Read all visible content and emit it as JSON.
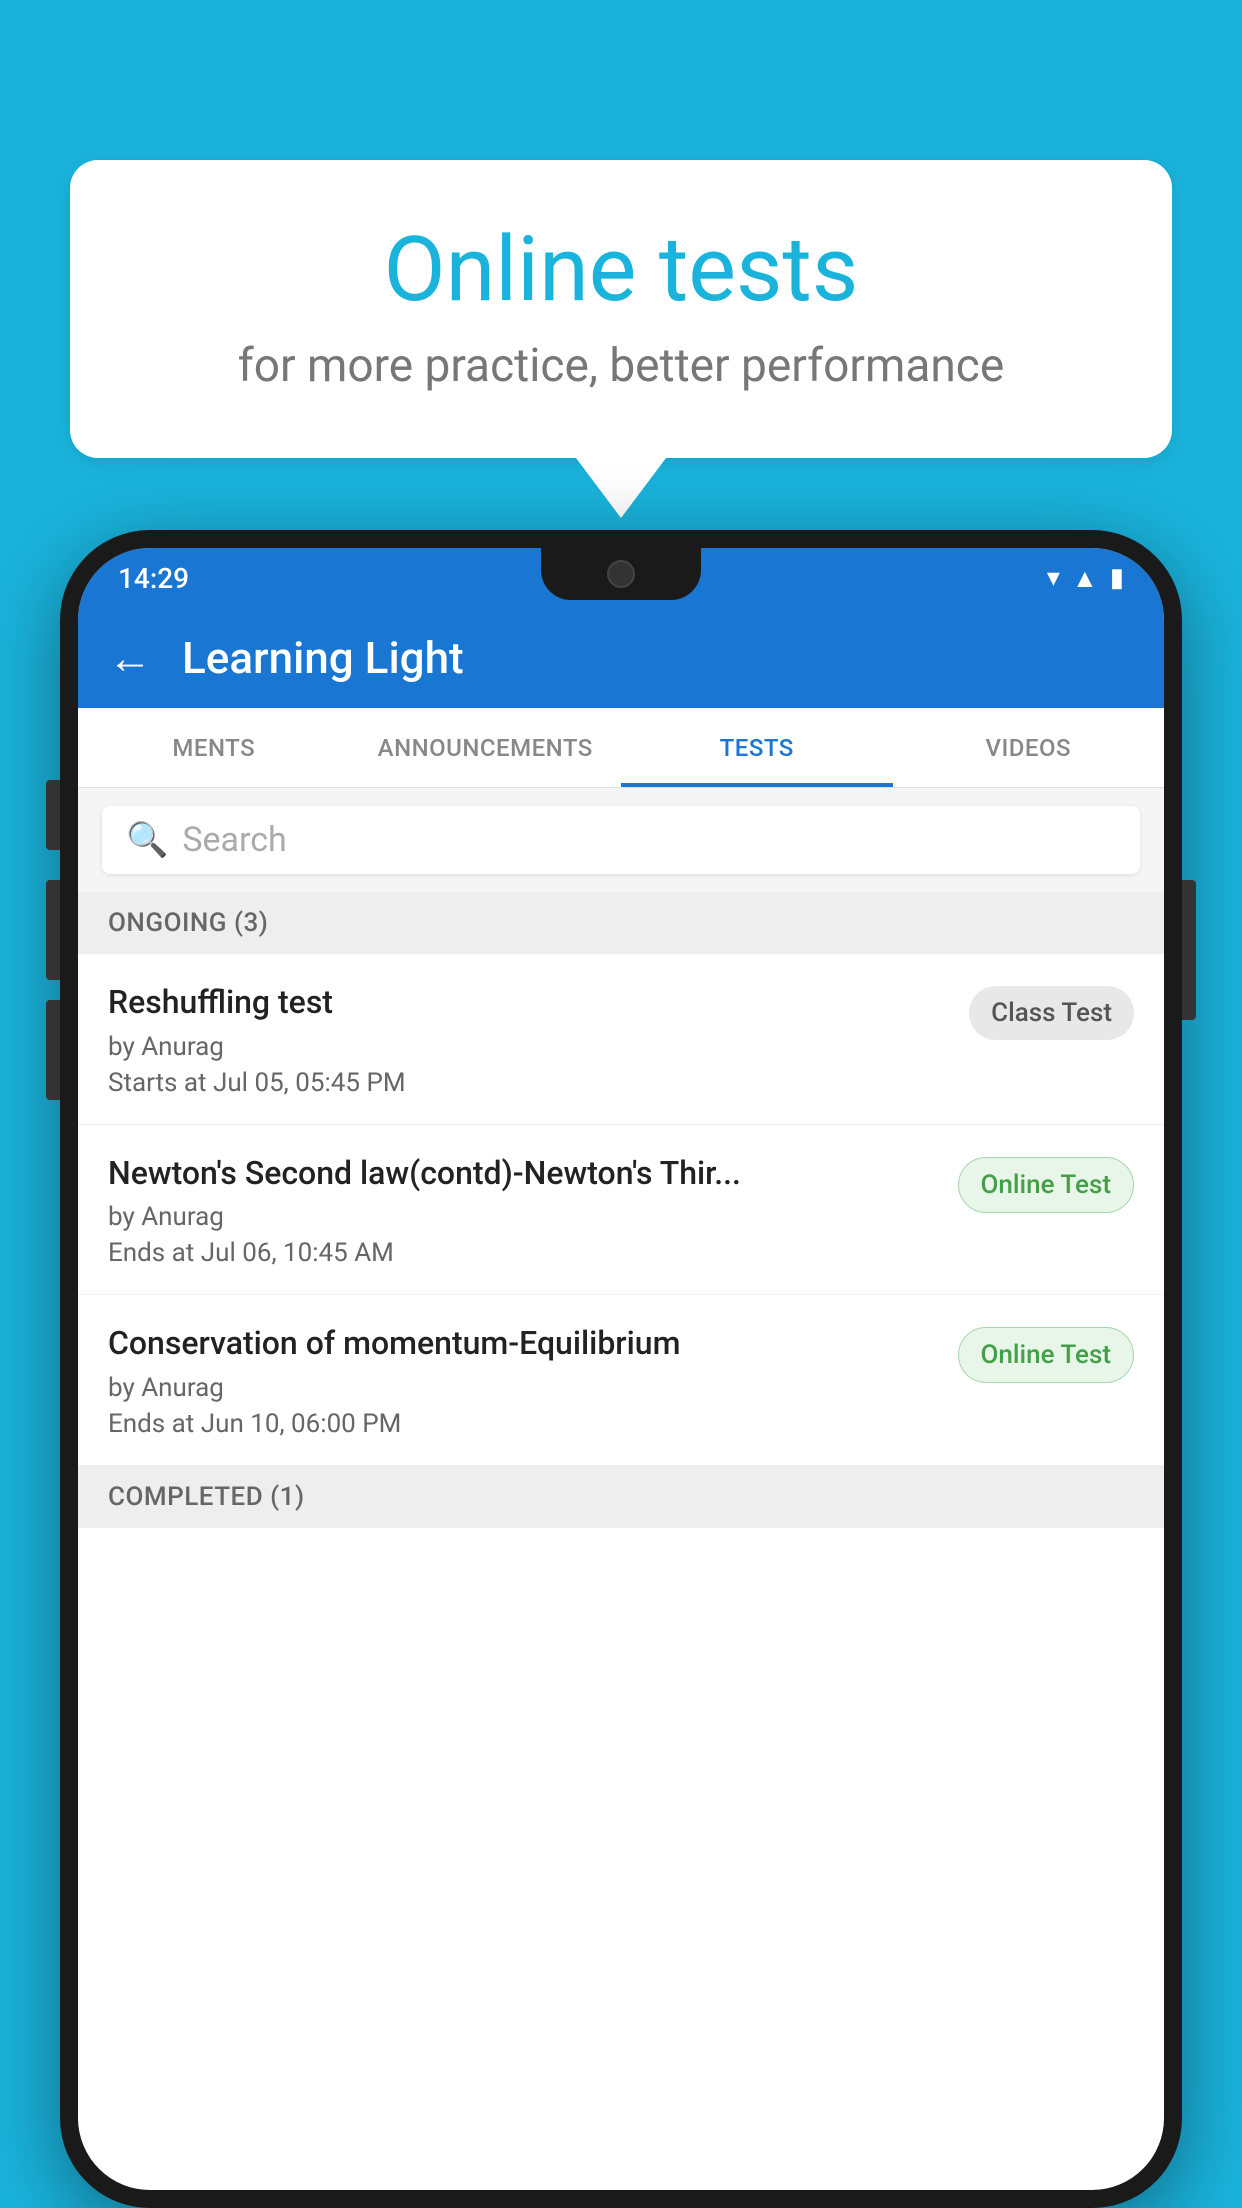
{
  "background_color": "#1ab3dc",
  "speech_bubble": {
    "title": "Online tests",
    "subtitle": "for more practice, better performance"
  },
  "phone": {
    "status_bar": {
      "time": "14:29",
      "icons": [
        "wifi",
        "signal",
        "battery"
      ]
    },
    "app_bar": {
      "back_label": "←",
      "title": "Learning Light"
    },
    "tabs": [
      {
        "label": "MENTS",
        "active": false
      },
      {
        "label": "ANNOUNCEMENTS",
        "active": false
      },
      {
        "label": "TESTS",
        "active": true
      },
      {
        "label": "VIDEOS",
        "active": false
      }
    ],
    "search": {
      "placeholder": "Search"
    },
    "ongoing_section": {
      "header": "ONGOING (3)",
      "items": [
        {
          "name": "Reshuffling test",
          "author": "by Anurag",
          "date": "Starts at  Jul 05, 05:45 PM",
          "badge": "Class Test",
          "badge_type": "class"
        },
        {
          "name": "Newton's Second law(contd)-Newton's Thir...",
          "author": "by Anurag",
          "date": "Ends at  Jul 06, 10:45 AM",
          "badge": "Online Test",
          "badge_type": "online"
        },
        {
          "name": "Conservation of momentum-Equilibrium",
          "author": "by Anurag",
          "date": "Ends at  Jun 10, 06:00 PM",
          "badge": "Online Test",
          "badge_type": "online"
        }
      ]
    },
    "completed_section": {
      "header": "COMPLETED (1)"
    }
  }
}
